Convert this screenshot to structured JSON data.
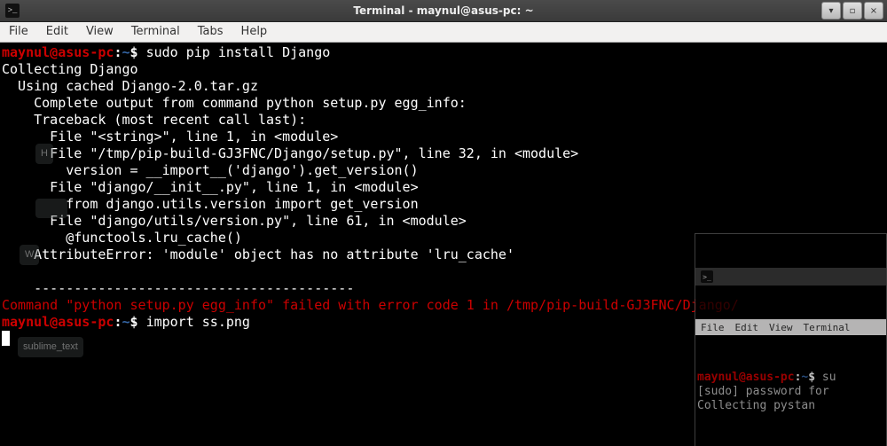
{
  "window": {
    "title": "Terminal - maynul@asus-pc: ~"
  },
  "window_controls": {
    "minimize": "▾",
    "maximize": "▫",
    "close": "×"
  },
  "menubar": [
    "File",
    "Edit",
    "View",
    "Terminal",
    "Tabs",
    "Help"
  ],
  "prompt": {
    "user_host": "maynul@asus-pc",
    "colon": ":",
    "path": "~",
    "symbol": "$"
  },
  "cmd1": "sudo pip install Django",
  "out": {
    "l1": "Collecting Django",
    "l2": "  Using cached Django-2.0.tar.gz",
    "l3": "    Complete output from command python setup.py egg_info:",
    "l4": "    Traceback (most recent call last):",
    "l5": "      File \"<string>\", line 1, in <module>",
    "l6": "      File \"/tmp/pip-build-GJ3FNC/Django/setup.py\", line 32, in <module>",
    "l7": "        version = __import__('django').get_version()",
    "l8": "      File \"django/__init__.py\", line 1, in <module>",
    "l9": "        from django.utils.version import get_version",
    "l10": "      File \"django/utils/version.py\", line 61, in <module>",
    "l11": "        @functools.lru_cache()",
    "l12": "    AttributeError: 'module' object has no attribute 'lru_cache'",
    "l13": "    ",
    "l14": "    ----------------------------------------",
    "err": "Command \"python setup.py egg_info\" failed with error code 1 in /tmp/pip-build-GJ3FNC/Django/"
  },
  "cmd2": "import ss.png",
  "ghosts": {
    "g1": "H",
    "g2": "",
    "g3": "W",
    "g4": "sublime_text"
  },
  "mini": {
    "menu": [
      "File",
      "Edit",
      "View",
      "Terminal"
    ],
    "l1_cmd": " su",
    "l2": "[sudo] password for ",
    "l3": "Collecting pystan"
  }
}
